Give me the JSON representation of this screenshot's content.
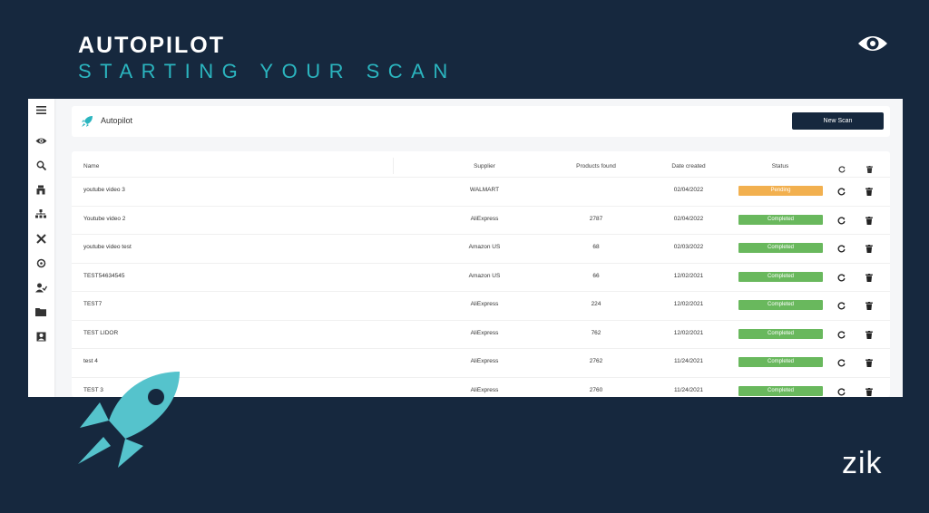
{
  "overlay": {
    "title": "AUTOPILOT",
    "subtitle": "STARTING YOUR SCAN",
    "brand": "zik"
  },
  "colors": {
    "background": "#16283e",
    "accent": "#2bb5bf",
    "pending": "#f2b04f",
    "completed": "#69b85d"
  },
  "sidebar": {
    "icons": [
      "menu-icon",
      "eye-icon",
      "search-icon",
      "store-icon",
      "sitemap-icon",
      "tools-icon",
      "crosshair-icon",
      "user-check-icon",
      "folder-icon",
      "user-icon"
    ]
  },
  "header": {
    "title": "Autopilot",
    "new_scan_label": "New Scan"
  },
  "table": {
    "columns": {
      "name": "Name",
      "supplier": "Supplier",
      "products": "Products found",
      "date": "Date created",
      "status": "Status"
    },
    "rows": [
      {
        "name": "youtube video 3",
        "supplier": "WALMART",
        "products": "",
        "date": "02/04/2022",
        "status": "Pending"
      },
      {
        "name": "Youtube video 2",
        "supplier": "AliExpress",
        "products": "2787",
        "date": "02/04/2022",
        "status": "Completed"
      },
      {
        "name": "youtube video test",
        "supplier": "Amazon US",
        "products": "68",
        "date": "02/03/2022",
        "status": "Completed"
      },
      {
        "name": "TEST54634545",
        "supplier": "Amazon US",
        "products": "66",
        "date": "12/02/2021",
        "status": "Completed"
      },
      {
        "name": "TEST7",
        "supplier": "AliExpress",
        "products": "224",
        "date": "12/02/2021",
        "status": "Completed"
      },
      {
        "name": "TEST LIDOR",
        "supplier": "AliExpress",
        "products": "762",
        "date": "12/02/2021",
        "status": "Completed"
      },
      {
        "name": "test 4",
        "supplier": "AliExpress",
        "products": "2762",
        "date": "11/24/2021",
        "status": "Completed"
      },
      {
        "name": "TEST 3",
        "supplier": "AliExpress",
        "products": "2760",
        "date": "11/24/2021",
        "status": "Completed"
      }
    ]
  }
}
